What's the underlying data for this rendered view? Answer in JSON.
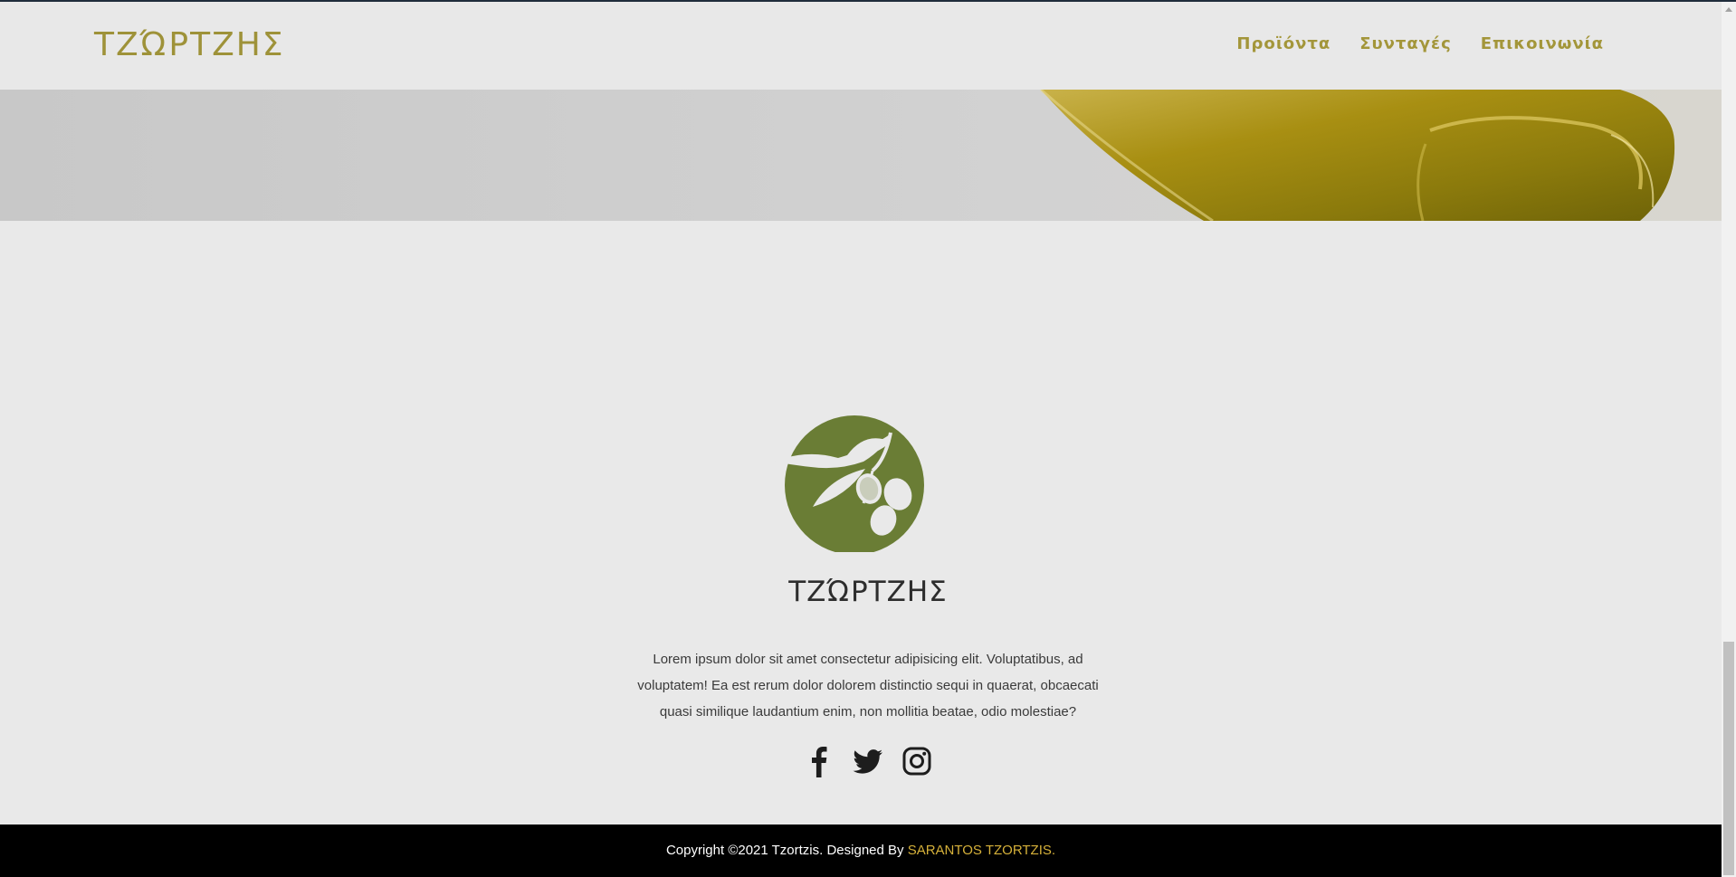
{
  "header": {
    "brand": "ΤΖΏΡΤΖΗΣ",
    "nav": [
      {
        "label": "Προϊόντα"
      },
      {
        "label": "Συνταγές"
      },
      {
        "label": "Επικοινωνία"
      }
    ]
  },
  "footer": {
    "title": "ΤΖΏΡΤΖΗΣ",
    "description": "Lorem ipsum dolor sit amet consectetur adipisicing elit. Voluptatibus, ad voluptatem! Ea est rerum dolor dolorem distinctio sequi in quaerat, obcaecati quasi similique laudantium enim, non mollitia beatae, odio molestiae?",
    "social": [
      "facebook-icon",
      "twitter-icon",
      "instagram-icon"
    ]
  },
  "copyright": {
    "text": "Copyright ©2021 Tzortzis. Designed By ",
    "designer": "SARANTOS TZORTZIS."
  },
  "colors": {
    "accent": "#a3963a",
    "logo_green": "#6a7d35",
    "designer_link": "#d6b13a"
  }
}
